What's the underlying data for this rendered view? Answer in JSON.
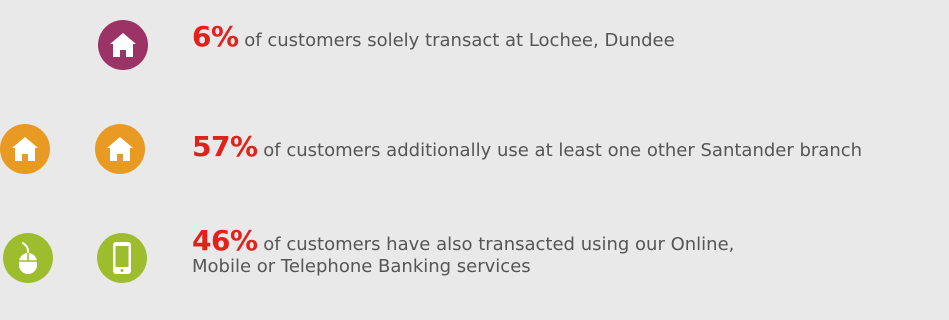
{
  "colors": {
    "background": "#e9e9e9",
    "purple": "#9b3366",
    "orange": "#e89a22",
    "green": "#9dbd2e",
    "percent_red": "#e3211b",
    "text_gray": "#555555"
  },
  "stats": [
    {
      "icons": [
        "house-icon"
      ],
      "percent": "6%",
      "text": " of customers solely transact at Lochee, Dundee"
    },
    {
      "icons": [
        "house-icon",
        "house-icon"
      ],
      "percent": "57%",
      "text": " of customers additionally use at least one other Santander branch"
    },
    {
      "icons": [
        "mouse-icon",
        "mobile-phone-icon"
      ],
      "percent": "46%",
      "text_line1": " of customers have also transacted using our Online,",
      "text_line2": "Mobile or Telephone Banking services"
    }
  ]
}
